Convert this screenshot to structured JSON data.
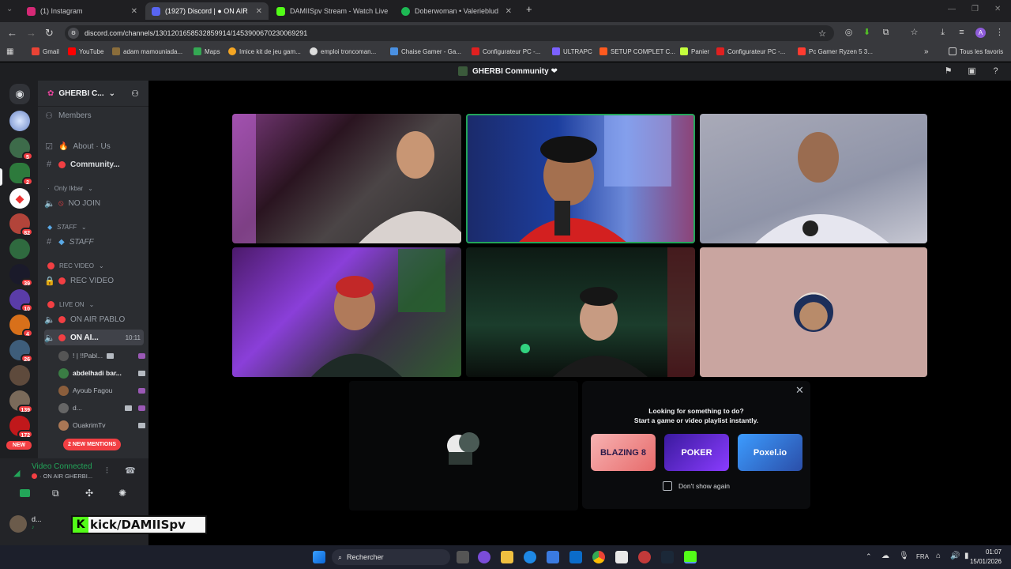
{
  "browser": {
    "tabs": [
      {
        "label": "(1) Instagram",
        "favicon_color": "#d62976"
      },
      {
        "label": "(1927) Discord | ● ON AIR",
        "favicon_color": "#5865f2"
      },
      {
        "label": "DAMIISpv Stream - Watch Live",
        "favicon_color": "#53fc18"
      },
      {
        "label": "Doberwoman • Valerieblud",
        "favicon_color": "#1db954"
      }
    ],
    "new_tab": "+",
    "url": "discord.com/channels/1301201658532859914/1453900670230069291",
    "bookmarks": [
      {
        "label": "Gmail",
        "color": "#ea4335"
      },
      {
        "label": "YouTube",
        "color": "#ff0000"
      },
      {
        "label": "adam mamouniada...",
        "color": "#8a6d3b"
      },
      {
        "label": "Maps",
        "color": "#34a853"
      },
      {
        "label": "Imice kit de jeu gam...",
        "color": "#f5a623"
      },
      {
        "label": "emploi troncoman...",
        "color": "#dddddd"
      },
      {
        "label": "Chaise Gamer - Ga...",
        "color": "#4a90e2"
      },
      {
        "label": "Configurateur PC -...",
        "color": "#e02020"
      },
      {
        "label": "ULTRAPC",
        "color": "#7b61ff"
      },
      {
        "label": "SETUP COMPLET C...",
        "color": "#ff5a1f"
      },
      {
        "label": "Panier",
        "color": "#c4ff3d"
      },
      {
        "label": "Configurateur PC -...",
        "color": "#e02020"
      },
      {
        "label": "Pc Gamer Ryzen 5 3...",
        "color": "#ff3b30"
      }
    ],
    "all_bookmarks": "Tous les favoris"
  },
  "discord": {
    "window_title": "GHERBI Community ❤",
    "server_name": "GHERBI C...",
    "members_label": "Members",
    "server_badges": [
      "5",
      "2",
      "82",
      "39",
      "10",
      "4",
      "26",
      "139",
      "172"
    ],
    "new_label": "NEW",
    "channels": {
      "about": "About · Us",
      "community": "Community...",
      "cat_only": "Only Ikbar",
      "no_join": "NO JOIN",
      "cat_staff": "STAFF",
      "staff": "STAFF",
      "cat_rec": "REC VIDEO",
      "rec": "REC VIDEO",
      "cat_live": "LIVE ON",
      "on_air_pablo": "ON AIR PABLO",
      "on_air": "ON AI...",
      "on_air_time": "10:11"
    },
    "voice_users": [
      {
        "name": "! | !!Pabl...",
        "color": "#555"
      },
      {
        "name": "abdelhadi bar...",
        "color": "#3a7d44"
      },
      {
        "name": "Ayoub Fagou",
        "color": "#8b5e3c"
      },
      {
        "name": "d...",
        "color": "#666"
      },
      {
        "name": "OuakrimTv",
        "color": "#aa7755"
      }
    ],
    "mentions": "2 NEW MENTIONS",
    "voice_status": "Video Connected",
    "voice_channel": "· ON AIR GHERBI...",
    "user_name": "d...",
    "activity": {
      "line1": "Looking for something to do?",
      "line2": "Start a game or video playlist instantly.",
      "games": [
        {
          "title": "BLAZING 8",
          "color": "#f28b8b"
        },
        {
          "title": "POKER",
          "color": "#5b2bd6"
        },
        {
          "title": "Poxel.io",
          "color": "#2d6ee3"
        }
      ],
      "dont_show": "Don't show again"
    }
  },
  "overlay": {
    "kick": "kick/DAMIISpv",
    "k": "K"
  },
  "taskbar": {
    "search": "Rechercher",
    "lang": "FRA",
    "time": "01:07",
    "date": "15/01/2026"
  }
}
